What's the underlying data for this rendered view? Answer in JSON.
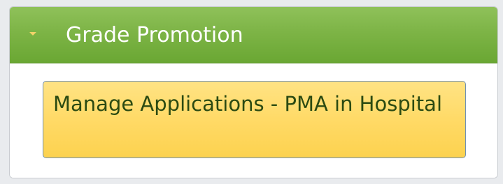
{
  "panel": {
    "header": {
      "title": "Grade Promotion",
      "icon": "chevron-down-icon"
    },
    "items": [
      {
        "label": "Manage Applications - PMA in Hospital"
      }
    ]
  },
  "colors": {
    "header_green": "#7db446",
    "item_yellow": "#ffd964",
    "item_text": "#2b4a12",
    "item_border": "#6e8fb5",
    "chevron": "#f3d36a"
  }
}
